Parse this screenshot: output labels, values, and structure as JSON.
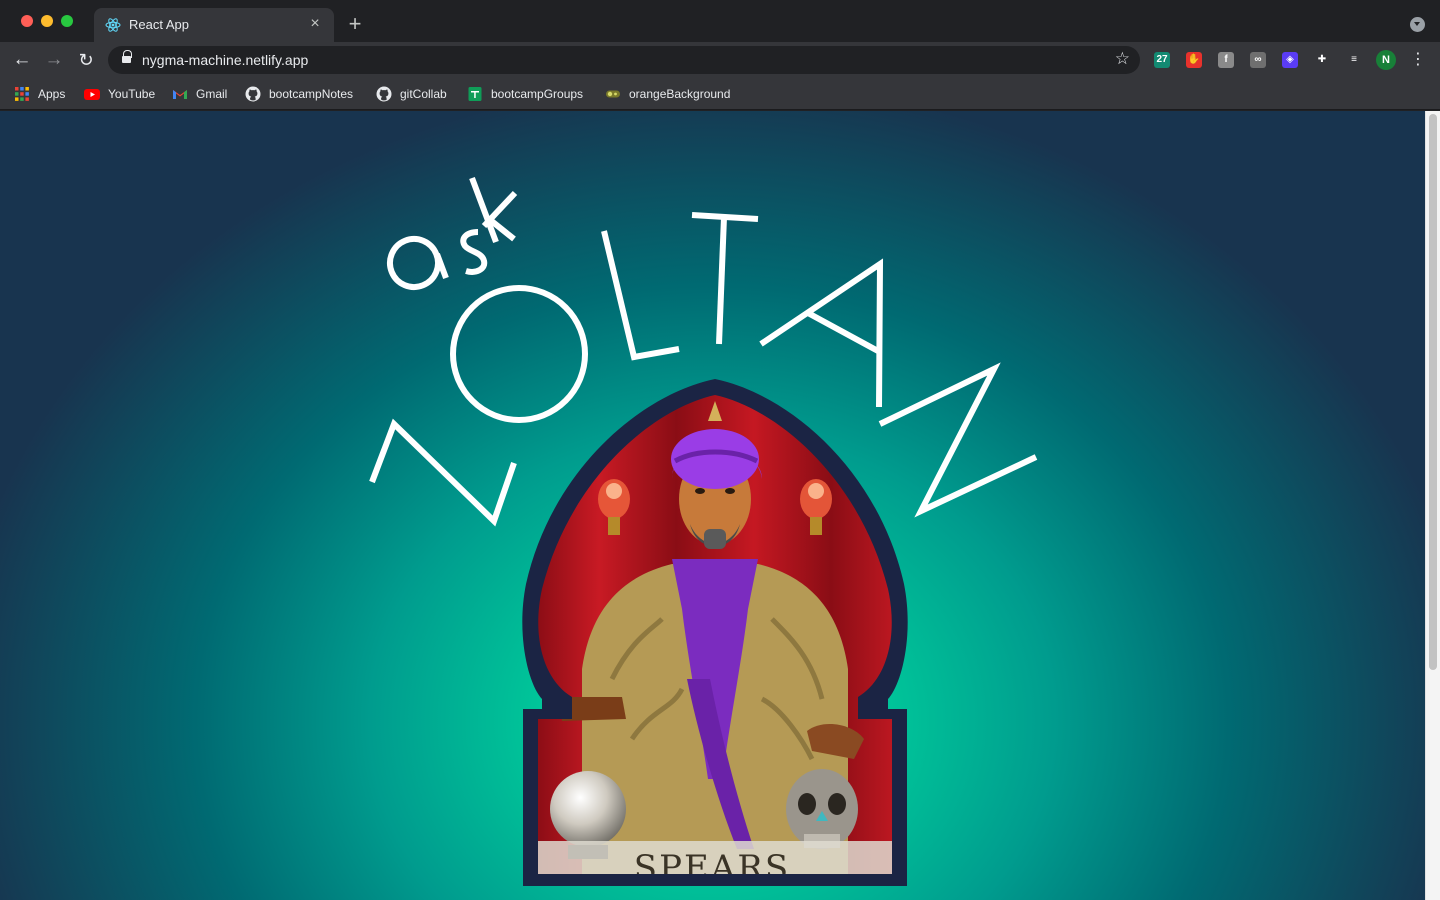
{
  "browser": {
    "tab": {
      "title": "React App",
      "close_icon": "×"
    },
    "new_tab_icon": "+",
    "address_bar": {
      "url": "nygma-machine.netlify.app"
    },
    "profile_initial": "N",
    "extensions": [
      {
        "name": "calendar-27-extension-icon",
        "label": "27",
        "color": "#138a72"
      },
      {
        "name": "adblock-extension-icon",
        "label": "✋",
        "color": "#e8322c"
      },
      {
        "name": "font-extension-icon",
        "label": "f",
        "color": "#8a8a8a"
      },
      {
        "name": "link-extension-icon",
        "label": "∞",
        "color": "#6f6f6f"
      },
      {
        "name": "purple-extension-icon",
        "label": "◈",
        "color": "#5a3cf5"
      },
      {
        "name": "puzzle-extensions-icon",
        "label": "✚",
        "color": "transparent"
      },
      {
        "name": "media-queue-icon",
        "label": "≡",
        "color": "transparent"
      }
    ]
  },
  "bookmarks": [
    {
      "label": "Apps",
      "icon": "apps-grid-icon"
    },
    {
      "label": "YouTube",
      "icon": "youtube-icon"
    },
    {
      "label": "Gmail",
      "icon": "gmail-icon"
    },
    {
      "label": "bootcampNotes",
      "icon": "github-icon"
    },
    {
      "label": "gitCollab",
      "icon": "github-icon"
    },
    {
      "label": "bootcampGroups",
      "icon": "sheets-icon"
    },
    {
      "label": "orangeBackground",
      "icon": "toggle-icon"
    }
  ],
  "page": {
    "title_small": "ask",
    "title_large": "ZOLTAN",
    "machine_sign": "SPEARS",
    "colors": {
      "background_center": "#00e0a4",
      "background_edge": "#18344f",
      "arch_frame": "#1b2444",
      "curtain": "#b5121b",
      "turban": "#8e35d6",
      "robe": "#b59a55"
    }
  }
}
